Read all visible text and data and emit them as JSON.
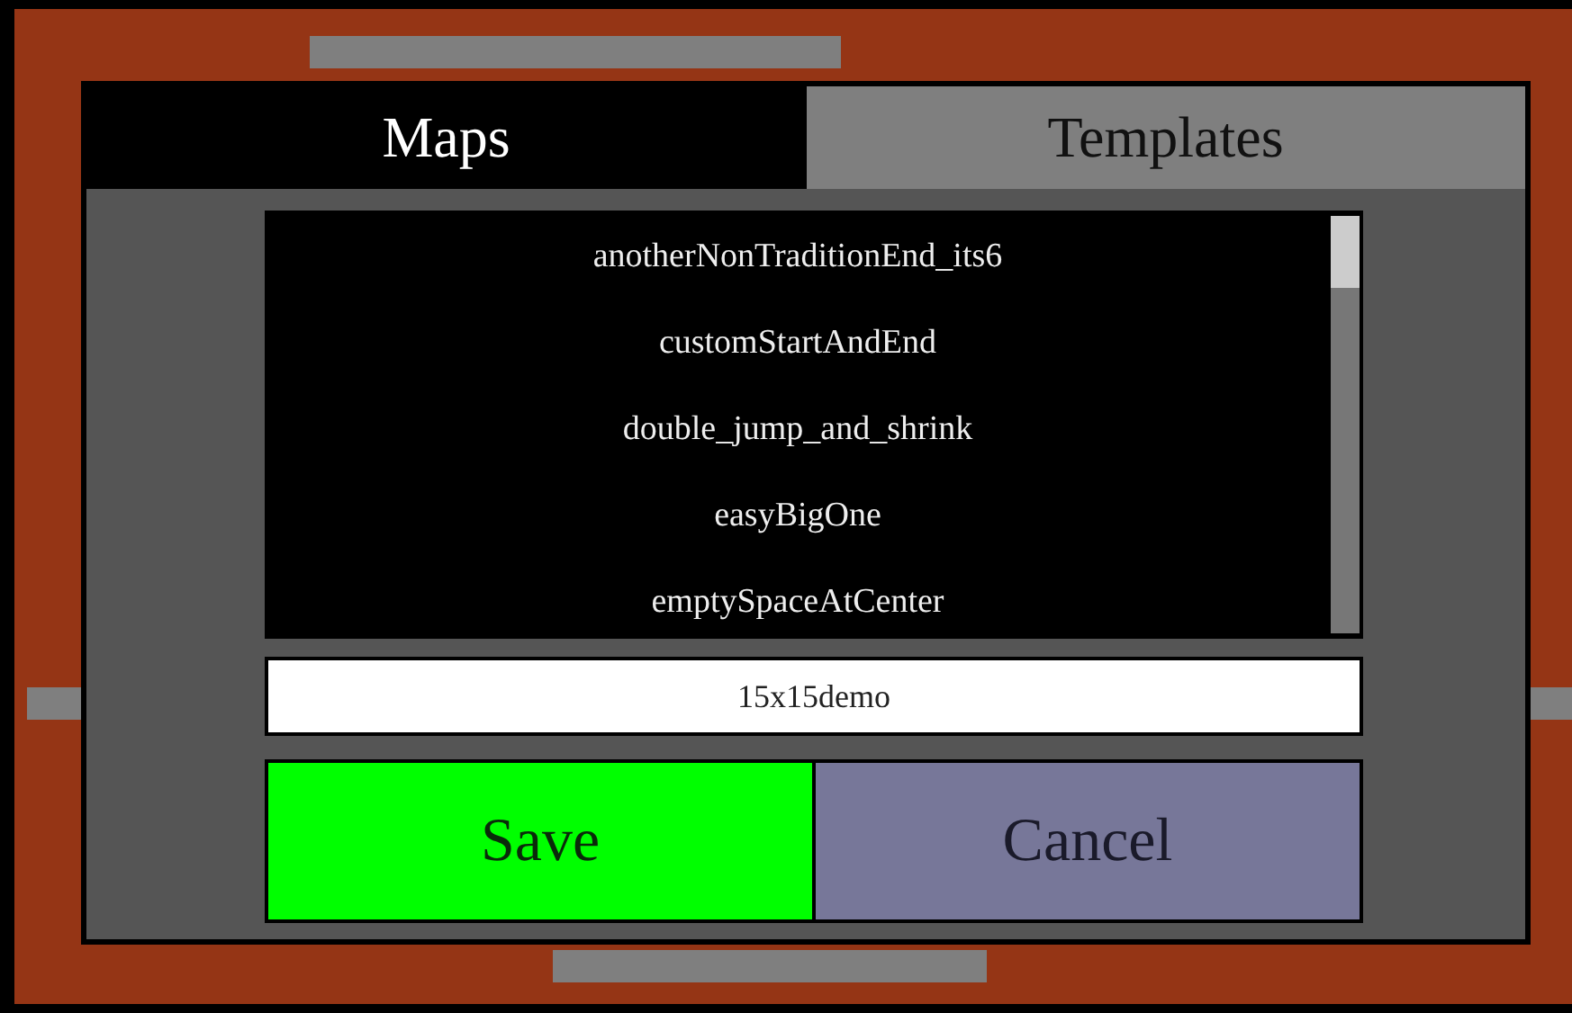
{
  "tabs": [
    {
      "label": "Maps",
      "selected": true
    },
    {
      "label": "Templates",
      "selected": false
    }
  ],
  "maps": [
    {
      "name": "anotherNonTraditionEnd_its6"
    },
    {
      "name": "customStartAndEnd"
    },
    {
      "name": "double_jump_and_shrink"
    },
    {
      "name": "easyBigOne"
    },
    {
      "name": "emptySpaceAtCenter"
    }
  ],
  "name_field": {
    "value": "15x15demo"
  },
  "buttons": [
    {
      "label": "Save",
      "kind": "save"
    },
    {
      "label": "Cancel",
      "kind": "cancel"
    }
  ]
}
